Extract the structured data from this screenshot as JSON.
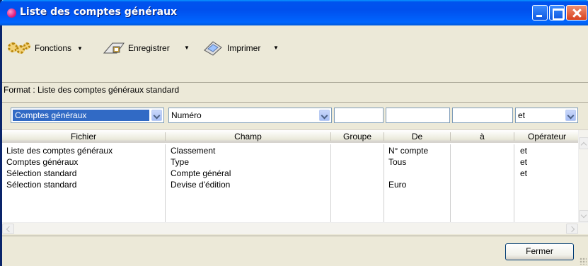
{
  "window": {
    "title": "Liste des comptes généraux"
  },
  "toolbar": {
    "fonctions_label": "Fonctions",
    "enregistrer_label": "Enregistrer",
    "imprimer_label": "Imprimer"
  },
  "format_text": "Format : Liste des comptes généraux standard",
  "filters": {
    "fichier": "Comptes généraux",
    "champ": "Numéro",
    "groupe": "",
    "de": "",
    "a": "",
    "operateur": "et"
  },
  "grid": {
    "columns": [
      "Fichier",
      "Champ",
      "Groupe",
      "De",
      "à",
      "Opérateur"
    ],
    "rows": [
      [
        "Liste des comptes généraux",
        "Classement",
        "",
        "N° compte",
        "",
        "et"
      ],
      [
        "Comptes généraux",
        "Type",
        "",
        "Tous",
        "",
        "et"
      ],
      [
        "Sélection standard",
        "Compte général",
        "",
        "",
        "",
        "et"
      ],
      [
        "Sélection standard",
        "Devise d'édition",
        "",
        "Euro",
        "",
        ""
      ]
    ]
  },
  "buttons": {
    "close_label": "Fermer"
  }
}
